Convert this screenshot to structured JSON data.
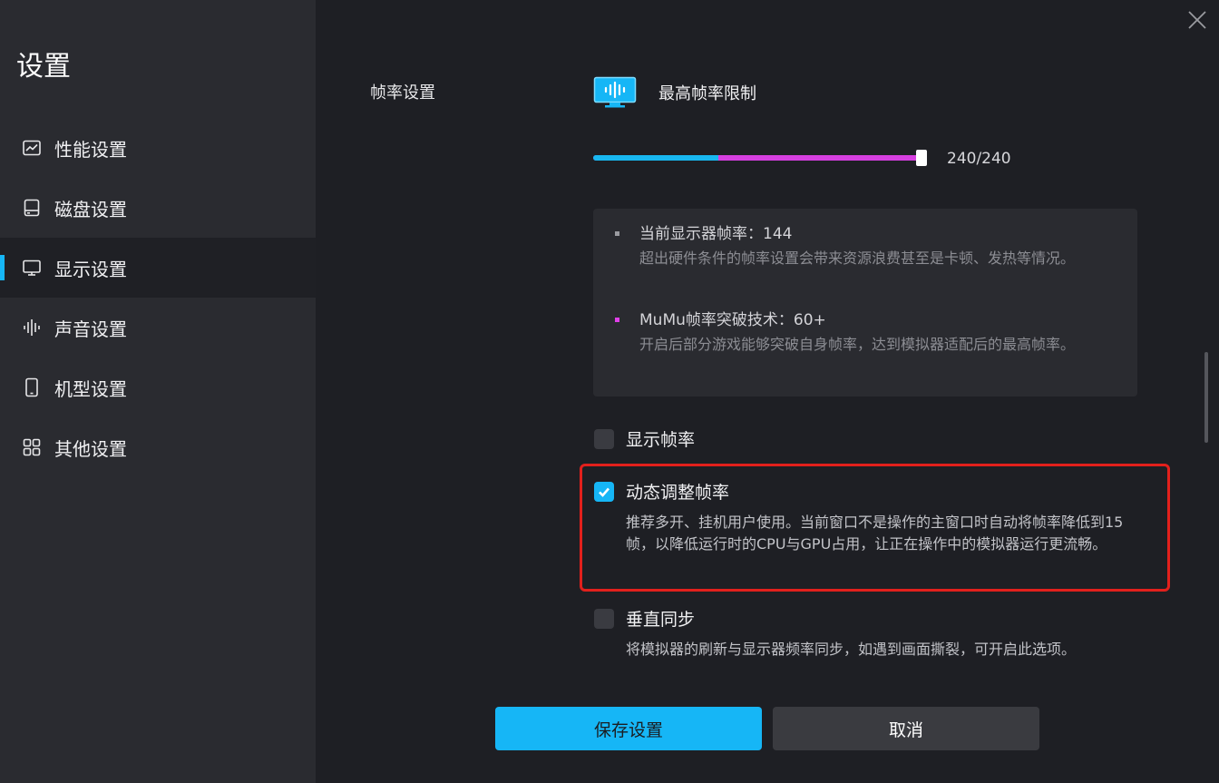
{
  "sidebar": {
    "title": "设置",
    "items": [
      {
        "label": "性能设置",
        "icon": "performance-chart-icon",
        "active": false
      },
      {
        "label": "磁盘设置",
        "icon": "disk-icon",
        "active": false
      },
      {
        "label": "显示设置",
        "icon": "display-icon",
        "active": true
      },
      {
        "label": "声音设置",
        "icon": "sound-wave-icon",
        "active": false
      },
      {
        "label": "机型设置",
        "icon": "phone-icon",
        "active": false
      },
      {
        "label": "其他设置",
        "icon": "grid-icon",
        "active": false
      }
    ]
  },
  "main": {
    "section_label": "帧率设置",
    "frame_rate": {
      "title": "最高帧率限制",
      "value": 240,
      "max": 240,
      "value_text": "240/240",
      "split_value": 60
    },
    "info": {
      "items": [
        {
          "head": "当前显示器帧率：144",
          "desc": "超出硬件条件的帧率设置会带来资源浪费甚至是卡顿、发热等情况。",
          "bullet_color": "#9a9ba0"
        },
        {
          "head": "MuMu帧率突破技术：60+",
          "desc": "开启后部分游戏能够突破自身帧率，达到模拟器适配后的最高帧率。",
          "bullet_color": "#e040e8"
        }
      ]
    },
    "options": {
      "show_fps": {
        "label": "显示帧率",
        "checked": false
      },
      "dynamic_fps": {
        "label": "动态调整帧率",
        "checked": true,
        "desc": "推荐多开、挂机用户使用。当前窗口不是操作的主窗口时自动将帧率降低到15帧，以降低运行时的CPU与GPU占用，让正在操作中的模拟器运行更流畅。"
      },
      "vsync": {
        "label": "垂直同步",
        "checked": false,
        "desc": "将模拟器的刷新与显示器频率同步，如遇到画面撕裂，可开启此选项。"
      }
    }
  },
  "buttons": {
    "save_label": "保存设置",
    "cancel_label": "取消"
  },
  "colors": {
    "accent": "#16b6f6",
    "slider_secondary": "#d63fe0",
    "highlight": "#e2201c"
  }
}
